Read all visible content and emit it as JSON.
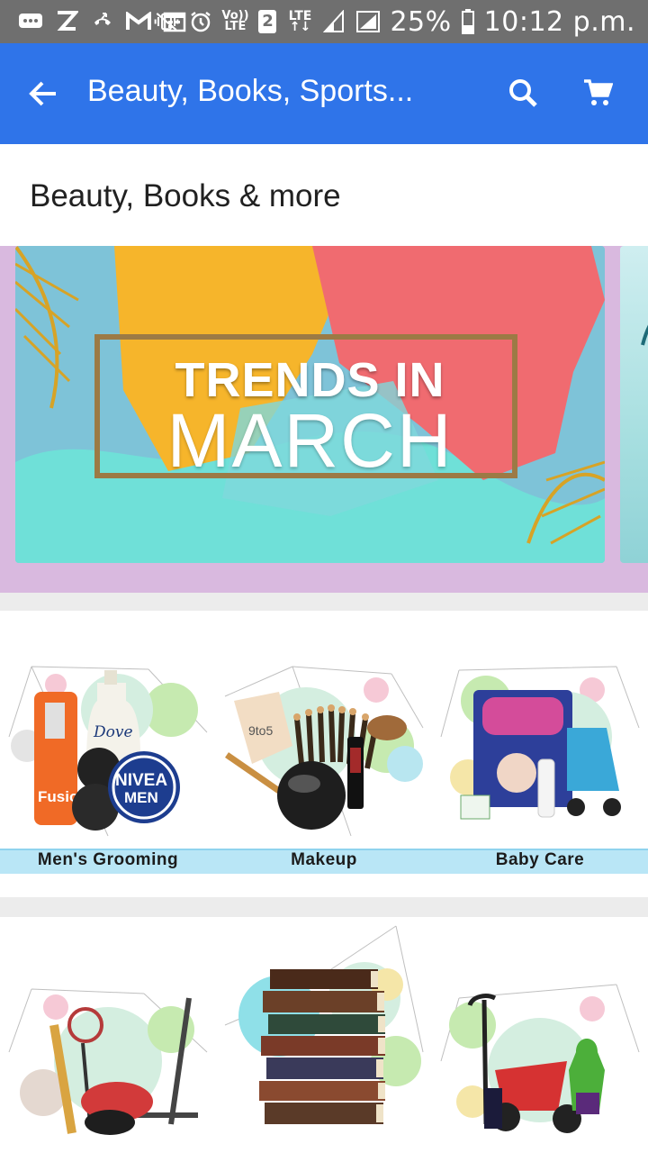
{
  "status_bar": {
    "time": "10:12 p.m.",
    "battery_percent": "25%",
    "sim_slot": "2",
    "lte_label": "LTE",
    "volte_top": "Vo))",
    "volte_bottom": "LTE",
    "left_icons": [
      "message-icon",
      "z-app-icon",
      "missed-call-icon",
      "gmail-icon",
      "calendar-icon"
    ],
    "right_icons": [
      "vibrate-icon",
      "alarm-icon",
      "volte-icon",
      "sim-2-icon",
      "lte-icon",
      "signal-icon",
      "signal-full-icon",
      "battery-icon"
    ]
  },
  "app_bar": {
    "title": "Beauty, Books, Sports...",
    "back_icon": "arrow-left-icon",
    "search_icon": "search-icon",
    "cart_icon": "cart-icon",
    "background": "#2f74e9"
  },
  "section": {
    "title": "Beauty, Books & more"
  },
  "banner": {
    "line1": "TRENDS IN",
    "line2": "MARCH",
    "strip_color": "#d9b9df"
  },
  "categories_row1": [
    {
      "label": "Men's Grooming"
    },
    {
      "label": "Makeup"
    },
    {
      "label": "Baby Care"
    }
  ],
  "categories_row2": [
    {
      "label": ""
    },
    {
      "label": ""
    },
    {
      "label": ""
    }
  ],
  "product_text": {
    "dove": "Dove",
    "nivea": "NIVEA",
    "nivea_men": "MEN",
    "fusion": "Fusion",
    "lakme": "9to5"
  }
}
